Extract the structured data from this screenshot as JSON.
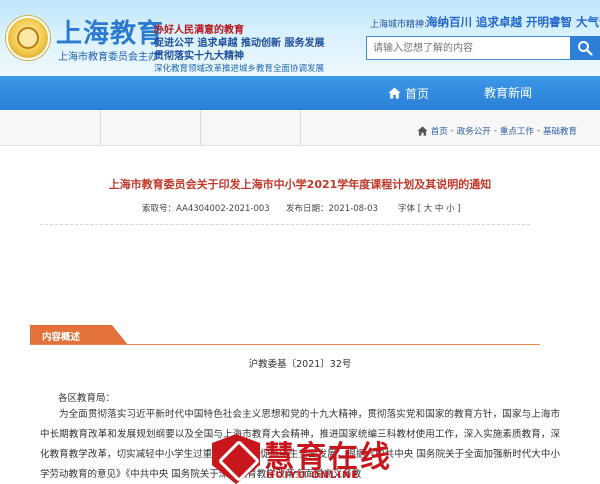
{
  "header": {
    "brand_title": "上海教育",
    "brand_sub": "上海市教育委员会主办",
    "slogans": [
      "办好人民满意的教育",
      "促进公平 追求卓越 推动创新 服务发展",
      "贯彻落实十九大精神",
      "深化教育领域改革推进城乡教育全面协调发展"
    ],
    "city_spirit_label": "上海城市精神:",
    "city_spirit_motto": "海纳百川 追求卓越 开明睿智 大气谦和",
    "search": {
      "placeholder": "请输入您想了解的内容",
      "icon": "search-icon"
    }
  },
  "nav": {
    "home_label": "首页",
    "news_label": "教育新闻",
    "home_icon": "home-icon"
  },
  "breadcrumb": {
    "icon": "home-icon",
    "items": [
      "首页",
      "政务公开",
      "重点工作",
      "基础教育"
    ],
    "separator": "-"
  },
  "article": {
    "title": "上海市教育委员会关于印发上海市中小学2021学年度课程计划及其说明的通知",
    "index_label": "索取号：AA4304002-2021-003",
    "date_label": "发布日期：2021-08-03",
    "font_label": "字体 [ 大 中 小 ]",
    "section_label": "内容概述",
    "doc_number": "沪教委基〔2021〕32号",
    "greeting": "各区教育局：",
    "paragraph": "为全面贯彻落实习近平新时代中国特色社会主义思想和党的十九大精神，贯彻落实党和国家的教育方针，国家与上海市中长期教育改革和发展规划纲要以及全国与上海市教育大会精神，推进国家统编三科教材使用工作，深入实施素质教育，深化教育教学改革，切实减轻中小学生过重课业负担，促进学生全面发展，根据《中共中央 国务院关于全面加强新时代大中小学劳动教育的意见》《中共中央 国务院关于深化教育教学改革全面提高义务教"
  },
  "watermark": {
    "cn": "慧育在线",
    "en": "HUIYU ONLINE"
  },
  "colors": {
    "brand_blue": "#2a7fd6",
    "title_red": "#c0392b",
    "section_orange": "#e2713a",
    "watermark_red": "#c8161d"
  }
}
